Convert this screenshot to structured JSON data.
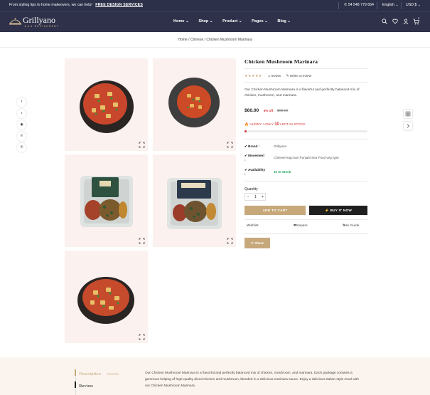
{
  "topbar": {
    "promo": "From styling tips to home makeovers, we can help!",
    "promo_link": "FREE DESIGN SERVICES",
    "phone": "54 548 779 654",
    "language": "English",
    "currency": "USD $"
  },
  "header": {
    "logo_name": "Grillyano",
    "logo_sub": "RESTAURANT",
    "nav": [
      "Home",
      "Shop",
      "Product",
      "Pages",
      "Blog"
    ],
    "cart_count": "0",
    "icons": [
      "search-icon",
      "heart-icon",
      "user-icon",
      "cart-icon"
    ]
  },
  "breadcrumb": [
    "Home",
    "Chinese",
    "Chicken Mushroom Marinara"
  ],
  "product": {
    "title": "Chicken Mushroom Marinara",
    "stars": "★★★★★",
    "review_count": "1 review",
    "write_review": "Write a review",
    "description": "Our Chicken Mushroom Marinara is a flavorful and perfectly balanced mix of chicken, mushroom, and marinara.",
    "price": "$60.00",
    "discount": "8% off",
    "old_price": "$65.00",
    "hurry_prefix": "HURRY ! ONLY",
    "hurry_count": "10",
    "hurry_suffix": "LEFT IN STOCK",
    "stock_level": 0.02,
    "meta": [
      {
        "label": "Brand",
        "value": "Grillyano"
      },
      {
        "label": "Movement",
        "value": "Chinese kaju kari Punjabi Sea Food veg type"
      },
      {
        "label": "Availability",
        "value": "10 In Stock"
      }
    ],
    "quantity_label": "Quantity",
    "quantity_value": "1",
    "add_to_cart": "ADD TO CART",
    "buy_now": "BUY IT NOW",
    "wishlist": "Wishlist",
    "compare": "Compare",
    "size_guide": "Size Guide",
    "share": "Share"
  },
  "tabs": {
    "description": "Description",
    "review": "Review",
    "description_text": "Our Chicken Mushroom Marinara is a flavorful and perfectly balanced mix of chicken, mushroom, and marinara. Each package contains a generous helping of high-quality diced chicken and mushroom, blended in a delicious marinara sauce. Enjoy a delicious Italian-style meal with our Chicken Mushroom Marinara."
  },
  "colors": {
    "dark": "#2c3048",
    "gold": "#c7a87b",
    "red": "#d63a3a",
    "green": "#1ea45c",
    "tile_bg": "#fbf1ee"
  }
}
